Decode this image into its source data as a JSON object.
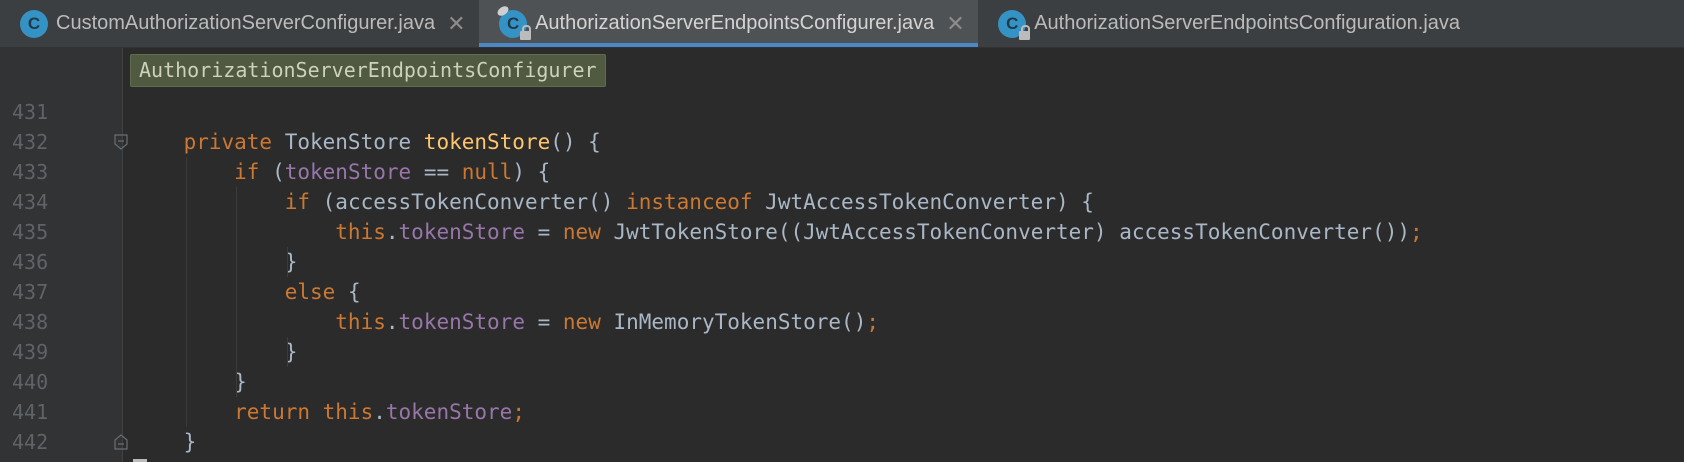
{
  "tabs": [
    {
      "title": "CustomAuthorizationServerConfigurer.java",
      "icon_letter": "C",
      "active": false,
      "locked": false,
      "pinned": false
    },
    {
      "title": "AuthorizationServerEndpointsConfigurer.java",
      "icon_letter": "C",
      "active": true,
      "locked": true,
      "pinned": true
    },
    {
      "title": "AuthorizationServerEndpointsConfiguration.java",
      "icon_letter": "C",
      "active": false,
      "locked": true,
      "pinned": false
    }
  ],
  "close_glyph": "✕",
  "breadcrumb": "AuthorizationServerEndpointsConfigurer",
  "code_lines": [
    {
      "num": "431",
      "tokens": []
    },
    {
      "num": "432",
      "tokens": [
        [
          "kw",
          "    private "
        ],
        [
          "ty",
          "TokenStore "
        ],
        [
          "fn",
          "tokenStore"
        ],
        [
          "ty",
          "() {"
        ]
      ]
    },
    {
      "num": "433",
      "tokens": [
        [
          "kw",
          "        if "
        ],
        [
          "ty",
          "("
        ],
        [
          "fld",
          "tokenStore"
        ],
        [
          "ty",
          " == "
        ],
        [
          "kw",
          "null"
        ],
        [
          "ty",
          ") {"
        ]
      ]
    },
    {
      "num": "434",
      "tokens": [
        [
          "kw",
          "            if "
        ],
        [
          "ty",
          "(accessTokenConverter() "
        ],
        [
          "kw",
          "instanceof "
        ],
        [
          "ty",
          "JwtAccessTokenConverter) {"
        ]
      ]
    },
    {
      "num": "435",
      "tokens": [
        [
          "kw",
          "                this"
        ],
        [
          "ty",
          "."
        ],
        [
          "fld",
          "tokenStore"
        ],
        [
          "ty",
          " = "
        ],
        [
          "kw",
          "new "
        ],
        [
          "ty",
          "JwtTokenStore((JwtAccessTokenConverter) accessTokenConverter())"
        ],
        [
          "kw",
          ";"
        ]
      ]
    },
    {
      "num": "436",
      "tokens": [
        [
          "ty",
          "            }"
        ]
      ]
    },
    {
      "num": "437",
      "tokens": [
        [
          "kw",
          "            else "
        ],
        [
          "ty",
          "{"
        ]
      ]
    },
    {
      "num": "438",
      "tokens": [
        [
          "kw",
          "                this"
        ],
        [
          "ty",
          "."
        ],
        [
          "fld",
          "tokenStore"
        ],
        [
          "ty",
          " = "
        ],
        [
          "kw",
          "new "
        ],
        [
          "ty",
          "InMemoryTokenStore()"
        ],
        [
          "kw",
          ";"
        ]
      ]
    },
    {
      "num": "439",
      "tokens": [
        [
          "ty",
          "            }"
        ]
      ]
    },
    {
      "num": "440",
      "tokens": [
        [
          "ty",
          "        }"
        ]
      ]
    },
    {
      "num": "441",
      "tokens": [
        [
          "kw",
          "        return this"
        ],
        [
          "ty",
          "."
        ],
        [
          "fld",
          "tokenStore"
        ],
        [
          "kw",
          ";"
        ]
      ]
    },
    {
      "num": "442",
      "tokens": [
        [
          "ty",
          "    }"
        ]
      ]
    }
  ],
  "colors": {
    "keyword": "#cc7832",
    "method": "#ffc66d",
    "field": "#9876aa",
    "text": "#a9b7c6",
    "accent": "#4a88c7",
    "class_icon": "#3592c4"
  }
}
